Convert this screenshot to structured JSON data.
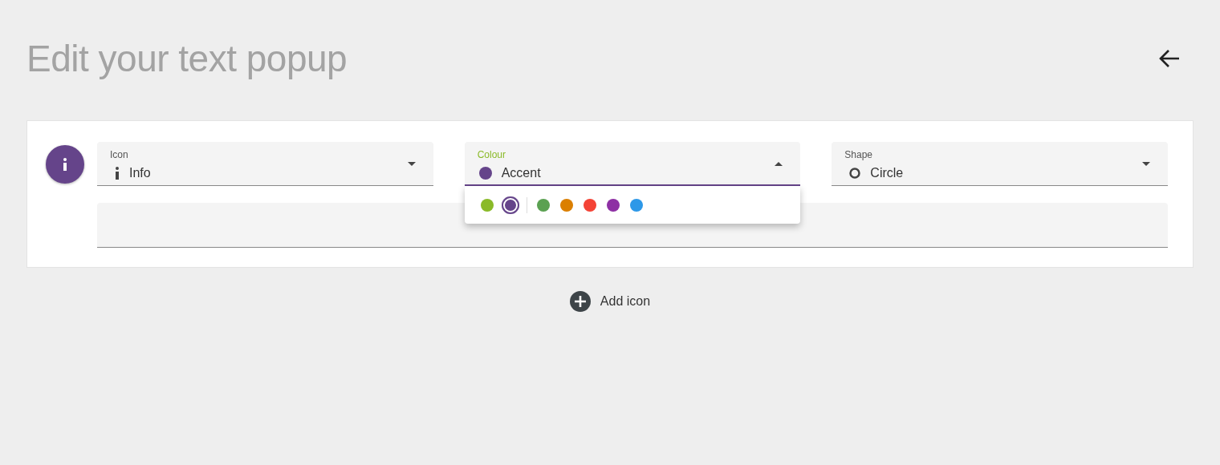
{
  "page": {
    "title": "Edit your text popup"
  },
  "back_button": {
    "kind": "arrow"
  },
  "card": {
    "avatar": {
      "color": "#65448a"
    },
    "fields": [
      {
        "label": "Icon",
        "value": "Info",
        "kind": "info",
        "open": false
      },
      {
        "label": "Colour",
        "value": "Accent",
        "kind": "swatch",
        "color": "#65448a",
        "open": true,
        "option_groups": [
          [
            {
              "color": "#8aba28",
              "selected": false
            },
            {
              "color": "#65448a",
              "selected": true
            }
          ],
          [
            {
              "color": "#5ba152",
              "selected": false
            },
            {
              "color": "#db7f00",
              "selected": false
            },
            {
              "color": "#f44336",
              "selected": false
            },
            {
              "color": "#8e30a4",
              "selected": false
            },
            {
              "color": "#2d98e8",
              "selected": false
            }
          ]
        ]
      },
      {
        "label": "Shape",
        "value": "Circle",
        "kind": "circle",
        "open": false
      }
    ],
    "text_field": {
      "kind": "empty"
    }
  },
  "add_button": {
    "label": "Add icon"
  }
}
